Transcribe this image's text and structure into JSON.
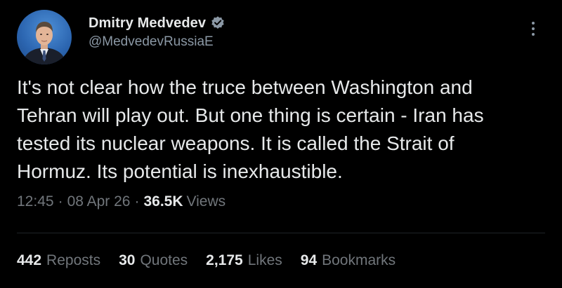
{
  "author": {
    "display_name": "Dmitry Medvedev",
    "handle": "@MedvedevRussiaE",
    "verified": true
  },
  "tweet": {
    "text": "It's not clear how the truce between Washington and\nTehran will play out. But one thing is certain - Iran has\ntested its nuclear weapons. It is called the Strait of\nHormuz. Its potential is inexhaustible.",
    "time": "12:45",
    "date": "08 Apr 26",
    "separator": "·",
    "views_count": "36.5K",
    "views_label": "Views"
  },
  "stats": {
    "reposts_count": "442",
    "reposts_label": "Reposts",
    "quotes_count": "30",
    "quotes_label": "Quotes",
    "likes_count": "2,175",
    "likes_label": "Likes",
    "bookmarks_count": "94",
    "bookmarks_label": "Bookmarks"
  },
  "colors": {
    "background": "#000000",
    "text_primary": "#e7e9ea",
    "text_secondary": "#71767b",
    "verified_badge": "#8b98a5",
    "avatar_background": "#2c66b1"
  },
  "icons": {
    "verified": "verified-badge-icon",
    "more": "more-vertical-icon"
  }
}
